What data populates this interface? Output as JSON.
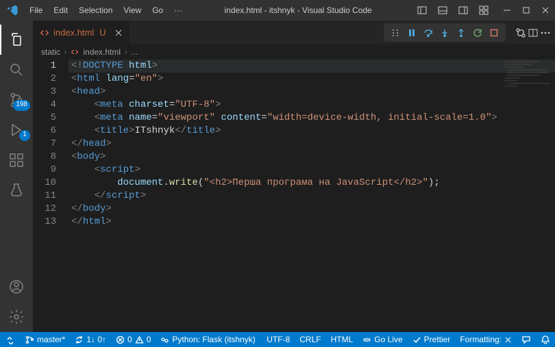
{
  "window": {
    "title": "index.html - itshnyk - Visual Studio Code"
  },
  "menu": {
    "file": "File",
    "edit": "Edit",
    "selection": "Selection",
    "view": "View",
    "go": "Go",
    "overflow": "···"
  },
  "activity": {
    "scm_badge": "198",
    "debug_badge": "1"
  },
  "tabs": {
    "active": {
      "name": "index.html",
      "modified": "U"
    }
  },
  "breadcrumb": {
    "folder": "static",
    "file": "index.html",
    "dots": "..."
  },
  "editor": {
    "line_numbers": [
      "1",
      "2",
      "3",
      "4",
      "5",
      "6",
      "7",
      "8",
      "9",
      "10",
      "11",
      "12",
      "13"
    ],
    "current_line": 1,
    "tokens": {
      "l1_br1": "<!",
      "l1_doctype": "DOCTYPE",
      "l1_space": " ",
      "l1_html": "html",
      "l1_br2": ">",
      "l2_br1": "<",
      "l2_html": "html",
      "l2_sp": " ",
      "l2_attr": "lang",
      "l2_eq": "=",
      "l2_val": "\"en\"",
      "l2_br2": ">",
      "l3_br1": "<",
      "l3_head": "head",
      "l3_br2": ">",
      "l4_pad": "    ",
      "l4_br1": "<",
      "l4_meta": "meta",
      "l4_sp": " ",
      "l4_attr": "charset",
      "l4_eq": "=",
      "l4_val": "\"UTF-8\"",
      "l4_br2": ">",
      "l5_pad": "    ",
      "l5_br1": "<",
      "l5_meta": "meta",
      "l5_sp1": " ",
      "l5_attr1": "name",
      "l5_eq1": "=",
      "l5_val1": "\"viewport\"",
      "l5_sp2": " ",
      "l5_attr2": "content",
      "l5_eq2": "=",
      "l5_val2": "\"width=device-width, initial-scale=1.0\"",
      "l5_br2": ">",
      "l6_pad": "    ",
      "l6_br1": "<",
      "l6_title": "title",
      "l6_br2": ">",
      "l6_text": "ITshnyk",
      "l6_br3": "</",
      "l6_title2": "title",
      "l6_br4": ">",
      "l7_br1": "</",
      "l7_head": "head",
      "l7_br2": ">",
      "l8_br1": "<",
      "l8_body": "body",
      "l8_br2": ">",
      "l9_pad": "    ",
      "l9_br1": "<",
      "l9_script": "script",
      "l9_br2": ">",
      "l10_pad": "        ",
      "l10_doc": "document",
      "l10_dot": ".",
      "l10_write": "write",
      "l10_p1": "(",
      "l10_str": "\"<h2>Перша програма на JavaScript</h2>\"",
      "l10_p2": ")",
      "l10_semi": ";",
      "l11_pad": "    ",
      "l11_br1": "</",
      "l11_script": "script",
      "l11_br2": ">",
      "l12_br1": "</",
      "l12_body": "body",
      "l12_br2": ">",
      "l13_br1": "</",
      "l13_html": "html",
      "l13_br2": ">"
    }
  },
  "status": {
    "branch": "master*",
    "sync": "1↓ 0↑",
    "errors": "0",
    "warnings": "0",
    "python": "Python: Flask (itshnyk)",
    "encoding": "UTF-8",
    "eol": "CRLF",
    "lang": "HTML",
    "golive": "Go Live",
    "prettier": "Prettier",
    "formatting": "Formatting:"
  }
}
